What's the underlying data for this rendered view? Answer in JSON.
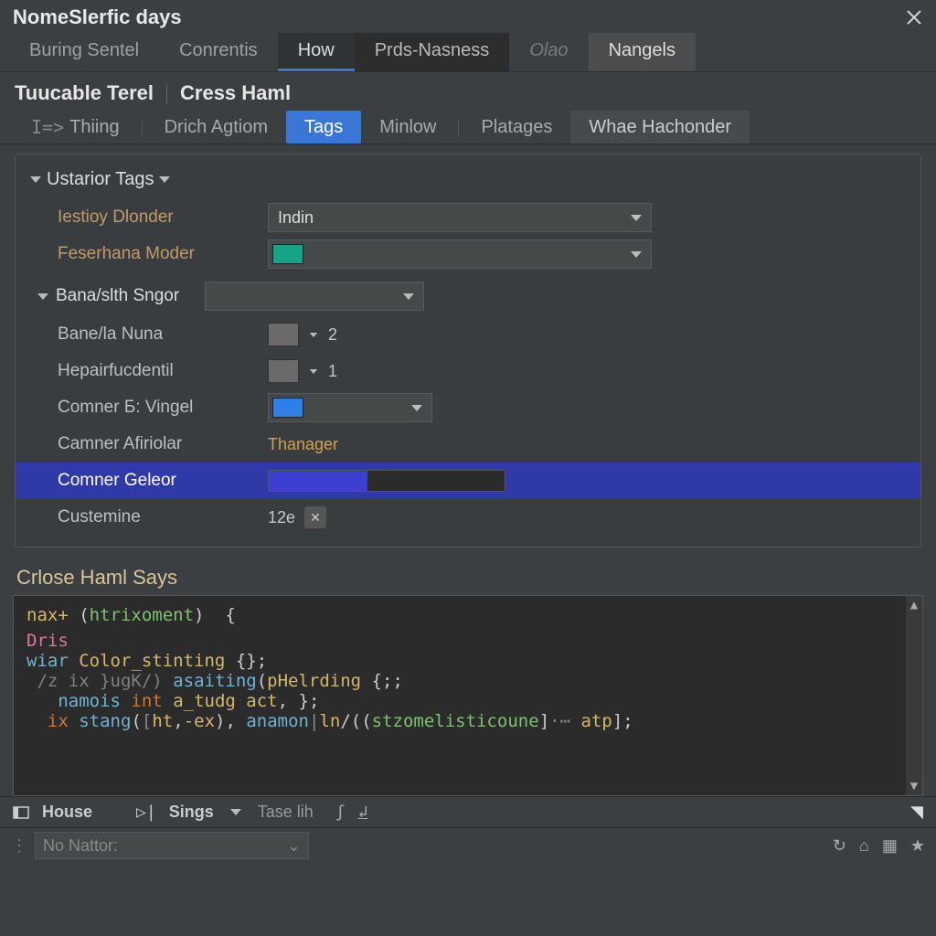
{
  "window": {
    "title": "NomeSlerfic days"
  },
  "primary_tabs": [
    {
      "label": "Buring Sentel"
    },
    {
      "label": "Conrentis"
    },
    {
      "label": "How",
      "active": true
    },
    {
      "label": "Prds-Nasness",
      "dark": true
    },
    {
      "label": "Olao",
      "muted": true
    },
    {
      "label": "Nangels",
      "last": true
    }
  ],
  "breadcrumb": {
    "a": "Tuucable Terel",
    "b": "Cress Haml"
  },
  "secondary_tabs": [
    {
      "label": "Thiing",
      "prefix": "I=>"
    },
    {
      "label": "Drich Agtiom"
    },
    {
      "label": "Tags",
      "active": true
    },
    {
      "label": "Minlow"
    },
    {
      "label": "Platages"
    },
    {
      "label": "Whae Hachonder",
      "box": true
    }
  ],
  "section": {
    "title": "Ustarior Tags",
    "rows": {
      "r1": {
        "label": "Iestioy Dlonder",
        "value": "Indin"
      },
      "r2": {
        "label": "Feserhana Moder",
        "swatch": "#17a589"
      }
    },
    "sub_title": "Bana/slth Sngor",
    "subrows": {
      "s1": {
        "label": "Bane/la Nuna",
        "value": "2"
      },
      "s2": {
        "label": "Hepairfucdentil",
        "value": "1"
      },
      "s3": {
        "label": "Comner Б: Vingel",
        "swatch": "#2f7fe6"
      },
      "s4": {
        "label": "Camner Afiriolar",
        "value": "Thanager"
      },
      "s5": {
        "label": "Comner Geleor",
        "fill": "#3d3fd1",
        "pct": 42
      },
      "s6": {
        "label": "Custemine",
        "value": "12e"
      }
    }
  },
  "code": {
    "title": "Crlose Haml Says",
    "l1a": "nax+",
    "l1b": "htrixoment",
    "l2": "Dris",
    "l3a": "wiar",
    "l3b": "Color_stinting",
    "l4a": "/z ix }ugK/)",
    "l4b": "asaiting",
    "l4c": "pHelrding",
    "l5a": "namois",
    "l5b": "int",
    "l5c": "a_tudg",
    "l5d": "act",
    "l6a": "ix",
    "l6b": "stang",
    "l6c": "ht",
    "l6d": "-ex",
    "l6e": "anamon",
    "l6f": "ln",
    "l6g": "stzomelisticoune",
    "l6h": "atp"
  },
  "footer": {
    "btn1": "House",
    "btn2": "Sings",
    "field": "Tase lih",
    "search_placeholder": "No Nattor:"
  }
}
